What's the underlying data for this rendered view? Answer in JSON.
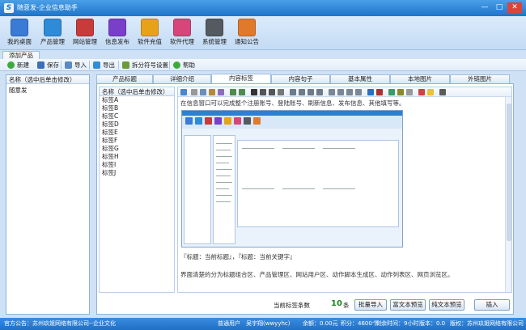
{
  "window": {
    "title": "随意发-企业信息助手",
    "logo": "S",
    "minimize": "—",
    "maximize": "□",
    "close": "✕"
  },
  "toolbar": {
    "items": [
      {
        "label": "我的桌面",
        "icon": "home-icon",
        "color": "#3a7bd5"
      },
      {
        "label": "产品管理",
        "icon": "cloud-icon",
        "color": "#2e8bd8"
      },
      {
        "label": "网站管理",
        "icon": "globe-icon",
        "color": "#c73b3b"
      },
      {
        "label": "信息发布",
        "icon": "publish-icon",
        "color": "#7a3fc9"
      },
      {
        "label": "软件充值",
        "icon": "recharge-icon",
        "color": "#e8a21a"
      },
      {
        "label": "软件代理",
        "icon": "agent-icon",
        "color": "#d8457a"
      },
      {
        "label": "系统管理",
        "icon": "gear-icon",
        "color": "#555a60"
      },
      {
        "label": "通知公告",
        "icon": "notice-icon",
        "color": "#e07a2a"
      }
    ]
  },
  "page_tab": "添加产品",
  "actions": {
    "new": "新建",
    "save": "保存",
    "import": "导入",
    "export": "导出",
    "split_setting": "拆分符号设置",
    "help": "帮助"
  },
  "left_panel": {
    "header": "名称（选中后单击修改）",
    "items": [
      "随意发"
    ]
  },
  "tabs": [
    "产品标题",
    "详细介绍",
    "内容标签",
    "内容句子",
    "基本属性",
    "本地图片",
    "外链图片"
  ],
  "active_tab": "内容标签",
  "tag_list": {
    "header": "名称（选中后单击修改）",
    "items": [
      "标签A",
      "标签B",
      "标签C",
      "标签D",
      "标签E",
      "标签F",
      "标签G",
      "标签H",
      "标签I",
      "标签J"
    ]
  },
  "editor": {
    "line1": "在信息窗口可以完成整个注册账号、登陆账号、刷新信息、发布信息、其他填写等。",
    "line2": "『标题：当前标题』，『标题：当前关键字』",
    "line3": "界面清楚的分为标题组合区、产品管理区、网站用户区、动作脚本生成区、动作列表区、网页浏览区。"
  },
  "bottom": {
    "count_label": "当前标签条数",
    "count_value": "10",
    "count_unit": "条",
    "batch_import": "批量导入",
    "rich_preview": "富文本预览",
    "plain_preview": "纯文本预览",
    "insert": "插入"
  },
  "status": {
    "notice": "官方公告：苏州玖姐网络有限公司--企业文化",
    "user_type": "普通用户",
    "username": "吴宇翔(wwyyhc)",
    "balance": "余额：0.00元",
    "points": "积分：4600个",
    "time_left": "剩余时间：9小时",
    "version": "版本：0.0",
    "company": "版权：苏州玖姐网络有限公司"
  }
}
